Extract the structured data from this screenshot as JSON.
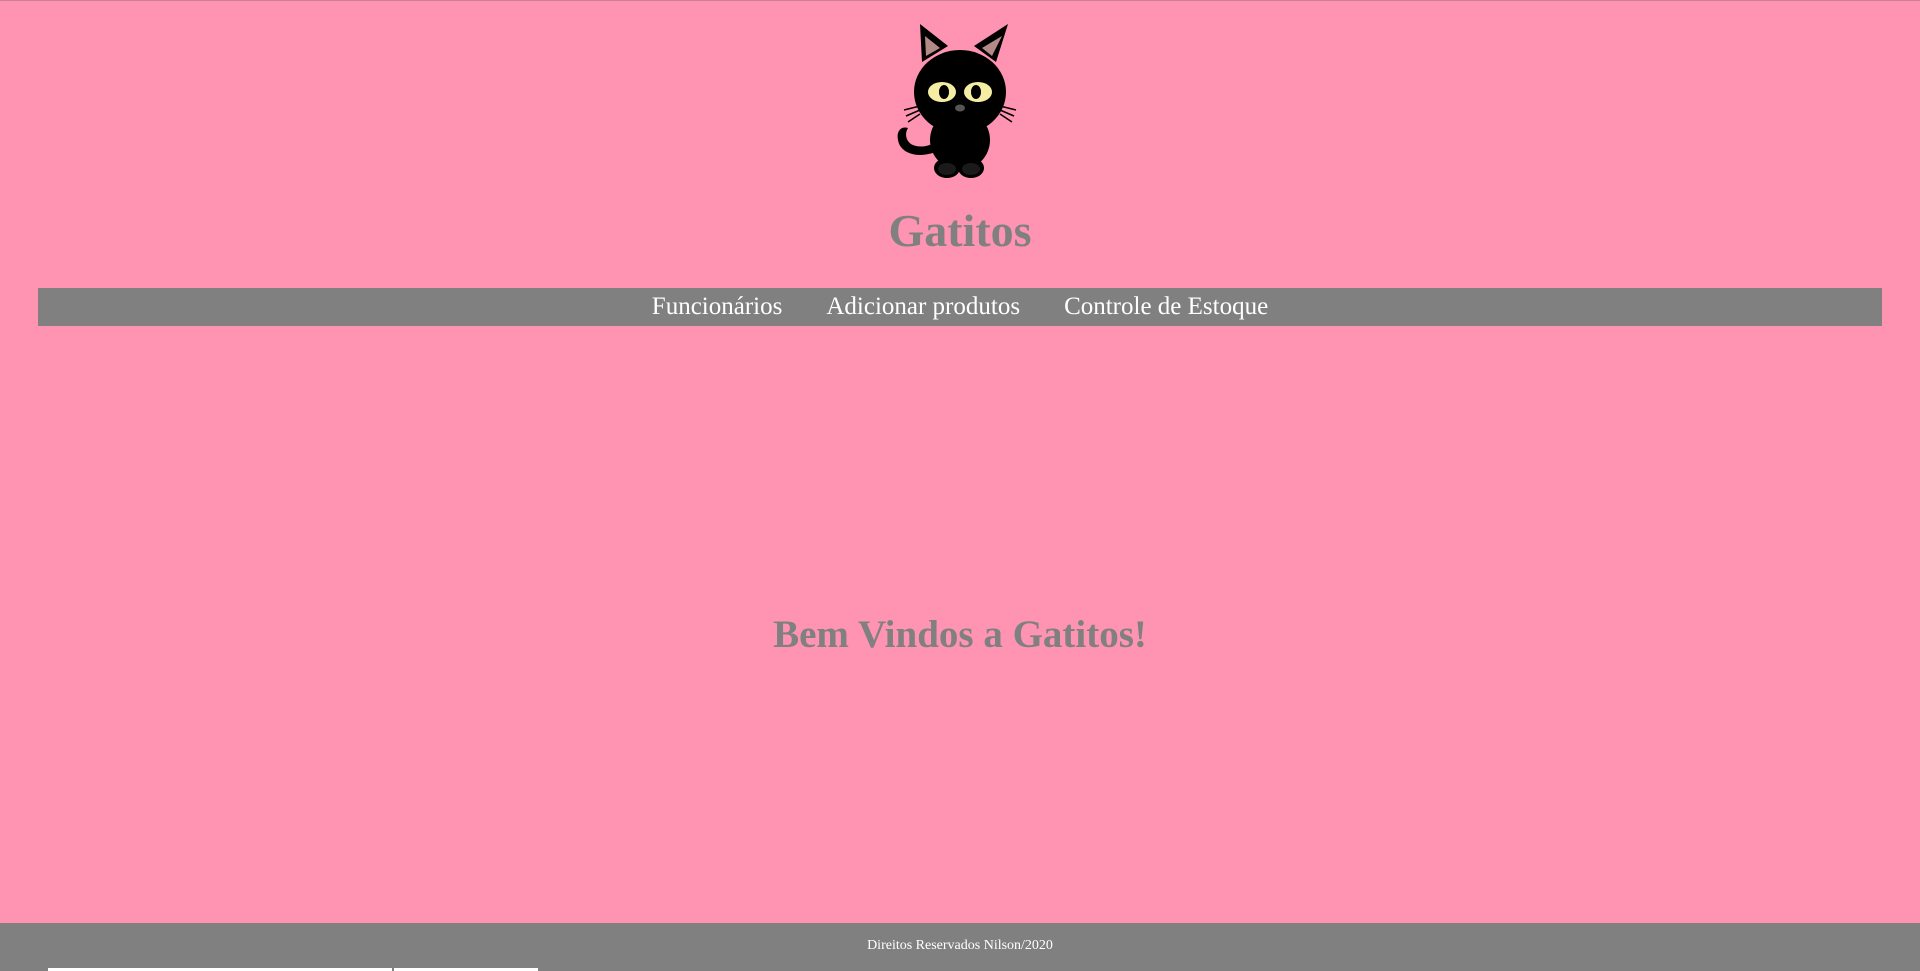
{
  "header": {
    "logo_icon": "black-cat-icon",
    "title": "Gatitos"
  },
  "nav": {
    "items": [
      {
        "label": "Funcionários"
      },
      {
        "label": "Adicionar produtos"
      },
      {
        "label": "Controle de Estoque"
      }
    ]
  },
  "main": {
    "welcome": "Bem Vindos a Gatitos!"
  },
  "footer": {
    "text": "Direitos Reservados Nilson/2020"
  },
  "colors": {
    "background": "#ff93b2",
    "bar": "#808080",
    "title_text": "#808080",
    "nav_text": "#ffffff",
    "cat_eyes": "#f5eda3"
  }
}
